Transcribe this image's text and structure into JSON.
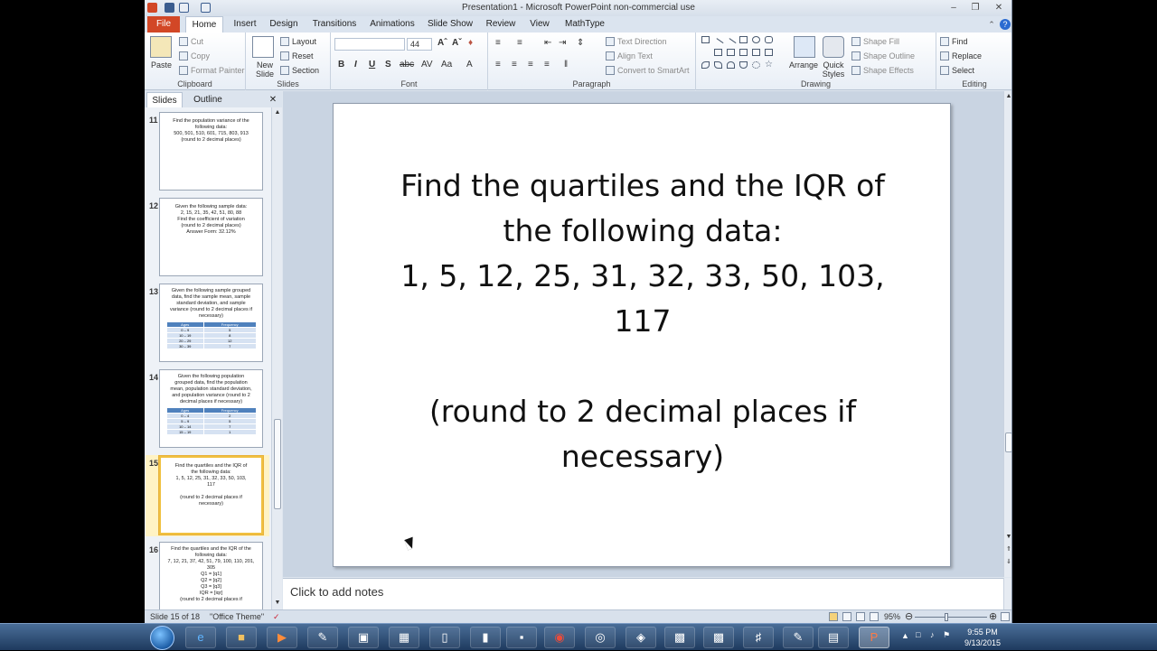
{
  "window": {
    "title": "Presentation1 - Microsoft PowerPoint non-commercial use"
  },
  "ribbon_tabs": [
    "File",
    "Home",
    "Insert",
    "Design",
    "Transitions",
    "Animations",
    "Slide Show",
    "Review",
    "View",
    "MathType"
  ],
  "ribbon": {
    "clipboard": {
      "paste": "Paste",
      "cut": "Cut",
      "copy": "Copy",
      "format_painter": "Format Painter",
      "label": "Clipboard"
    },
    "slides": {
      "new_slide": "New Slide",
      "layout": "Layout",
      "reset": "Reset",
      "section": "Section",
      "label": "Slides"
    },
    "font": {
      "size": "44",
      "label": "Font"
    },
    "paragraph": {
      "text_direction": "Text Direction",
      "align_text": "Align Text",
      "convert_smartart": "Convert to SmartArt",
      "label": "Paragraph"
    },
    "drawing": {
      "arrange": "Arrange",
      "quick_styles": "Quick Styles",
      "shape_fill": "Shape Fill",
      "shape_outline": "Shape Outline",
      "shape_effects": "Shape Effects",
      "label": "Drawing"
    },
    "editing": {
      "find": "Find",
      "replace": "Replace",
      "select": "Select",
      "label": "Editing"
    }
  },
  "pane_tabs": {
    "slides": "Slides",
    "outline": "Outline"
  },
  "thumbnails": [
    {
      "num": "11",
      "text": "Find the population variance of the\nfollowing data:\n500, 501, 510, 601, 715, 803, 913\n(round to 2 decimal places)"
    },
    {
      "num": "12",
      "text": "Given the following sample data:\n2, 15, 21, 35, 42, 51, 80, 88\nFind the coefficient of variation\n(round to 2 decimal places)\nAnswer Form: 32.12%"
    },
    {
      "num": "13",
      "text": "Given the following sample grouped\ndata, find the sample mean, sample\nstandard deviation, and sample\nvariance (round to 2 decimal places if\nnecessary)",
      "table": [
        [
          "Ages",
          "Frequency"
        ],
        [
          "0 – 9",
          "5"
        ],
        [
          "10 – 19",
          "8"
        ],
        [
          "20 – 29",
          "12"
        ],
        [
          "30 – 39",
          "7"
        ]
      ]
    },
    {
      "num": "14",
      "text": "Given the following population\ngrouped data, find the population\nmean, population standard deviation,\nand population variance (round to 2\ndecimal places if necessary)",
      "table": [
        [
          "Ages",
          "Frequency"
        ],
        [
          "0 – 4",
          "2"
        ],
        [
          "5 – 9",
          "5"
        ],
        [
          "10 – 14",
          "7"
        ],
        [
          "15 – 19",
          "1"
        ]
      ]
    },
    {
      "num": "15",
      "text": "Find the quartiles and the IQR of\nthe following data:\n1, 5, 12, 25, 31, 32, 33, 50, 103,\n117\n\n(round to 2 decimal places if\nnecessary)"
    },
    {
      "num": "16",
      "text": "Find the quartiles and the IQR of the\nfollowing data:\n7, 12, 21, 37, 42, 51, 79, 100, 110, 201,\n305\nQ1 = [q1]\nQ2 = [q2]\nQ3 = [q3]\nIQR = [iqr]\n(round to 2 decimal places if"
    }
  ],
  "slide": {
    "text": "Find the quartiles and the IQR of\nthe following data:\n1, 5, 12, 25, 31, 32, 33, 50, 103,\n117\n\n(round to 2 decimal places if\nnecessary)"
  },
  "notes": {
    "placeholder": "Click to add notes"
  },
  "status": {
    "slide_info": "Slide 15 of 18",
    "theme": "\"Office Theme\"",
    "zoom": "95%"
  },
  "clock": {
    "time": "9:55 PM",
    "date": "9/13/2015"
  }
}
